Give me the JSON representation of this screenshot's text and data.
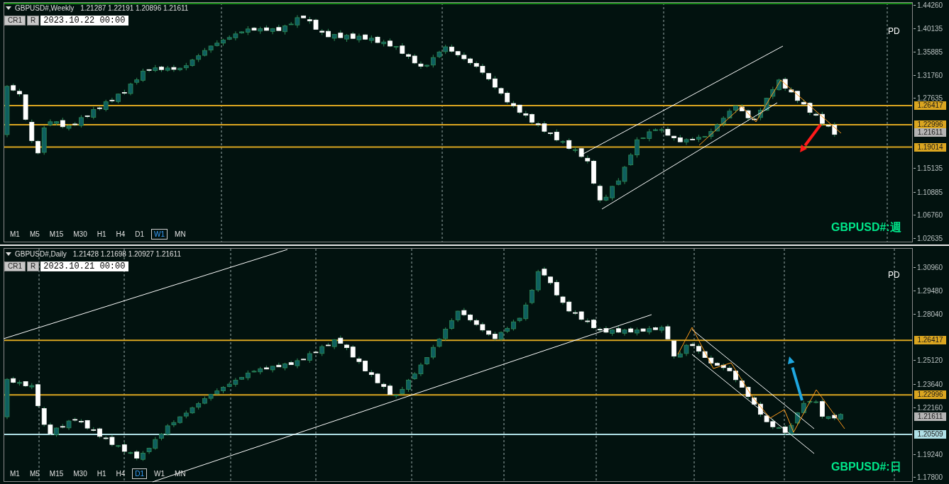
{
  "panels": [
    {
      "symbol": "GBPUSD#,Weekly",
      "ohlc": "1.21287 1.22191 1.20896 1.21611",
      "cr_button": "CR1",
      "r_button": "R",
      "date_field": "2023.10.22 00:00",
      "pd_label": "PD",
      "chart_title": "GBPUSD#:週",
      "price_ticks": [
        "1.44260",
        "1.40135",
        "1.35885",
        "1.31760",
        "1.27635",
        "1.15135",
        "1.10885",
        "1.06760",
        "1.02635"
      ],
      "price_lines": [
        {
          "price": "1.26417",
          "color": "#daa520"
        },
        {
          "price": "1.22996",
          "color": "#daa520"
        },
        {
          "price": "1.19014",
          "color": "#daa520"
        }
      ],
      "current_price": "1.21611",
      "timeframes": [
        {
          "label": "M1",
          "selected": false
        },
        {
          "label": "M5",
          "selected": false
        },
        {
          "label": "M15",
          "selected": false
        },
        {
          "label": "M30",
          "selected": false
        },
        {
          "label": "H1",
          "selected": false
        },
        {
          "label": "H4",
          "selected": false
        },
        {
          "label": "D1",
          "selected": false
        },
        {
          "label": "W1",
          "selected": true
        },
        {
          "label": "MN",
          "selected": false
        }
      ]
    },
    {
      "symbol": "GBPUSD#,Daily",
      "ohlc": "1.21428 1.21698 1.20927 1.21611",
      "cr_button": "CR1",
      "r_button": "R",
      "date_field": "2023.10.21 00:00",
      "pd_label": "PD",
      "chart_title": "GBPUSD#:日",
      "price_ticks": [
        "1.30960",
        "1.29480",
        "1.28040",
        "1.25120",
        "1.23640",
        "1.22160",
        "1.19240",
        "1.17800"
      ],
      "price_lines": [
        {
          "price": "1.26417",
          "color": "#daa520"
        },
        {
          "price": "1.22996",
          "color": "#daa520"
        },
        {
          "price": "1.20509",
          "color": "#b0e0e6"
        }
      ],
      "current_price": "1.21611",
      "timeframes": [
        {
          "label": "M1",
          "selected": false
        },
        {
          "label": "M5",
          "selected": false
        },
        {
          "label": "M15",
          "selected": false
        },
        {
          "label": "M30",
          "selected": false
        },
        {
          "label": "H1",
          "selected": false
        },
        {
          "label": "H4",
          "selected": false
        },
        {
          "label": "D1",
          "selected": true
        },
        {
          "label": "W1",
          "selected": false
        },
        {
          "label": "MN",
          "selected": false
        }
      ]
    }
  ]
}
